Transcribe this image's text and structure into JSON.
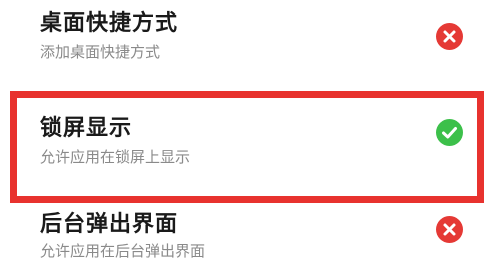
{
  "permissions": [
    {
      "title": "桌面快捷方式",
      "description": "添加桌面快捷方式",
      "status": "denied",
      "status_icon": "x-circle-icon",
      "status_color": "#e53935"
    },
    {
      "title": "锁屏显示",
      "description": "允许应用在锁屏上显示",
      "status": "allowed",
      "status_icon": "check-circle-icon",
      "status_color": "#3cc04a"
    },
    {
      "title": "后台弹出界面",
      "description": "允许应用在后台弹出界面",
      "status": "denied",
      "status_icon": "x-circle-icon",
      "status_color": "#e53935"
    }
  ],
  "highlight": {
    "color": "#e8322e"
  }
}
